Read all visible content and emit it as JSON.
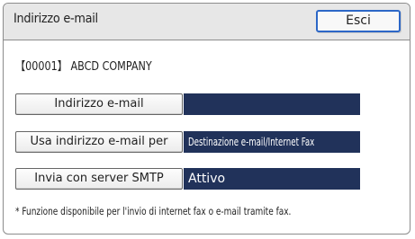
{
  "header": {
    "title": "Indirizzo e-mail",
    "exit_label": "Esci"
  },
  "company": "【00001】 ABCD COMPANY",
  "settings": [
    {
      "label": "Indirizzo e-mail",
      "value": ""
    },
    {
      "label": "Usa indirizzo e-mail per",
      "value": "Destinazione e-mail/Internet Fax"
    },
    {
      "label": "Invia con server SMTP",
      "value": "Attivo"
    }
  ],
  "footnote": "* Funzione disponibile per l'invio di internet fax o e-mail tramite fax.",
  "colors": {
    "value_bg": "#21325a",
    "exit_border": "#2c67c7",
    "titlebar_bg": "#e7e7e7"
  }
}
